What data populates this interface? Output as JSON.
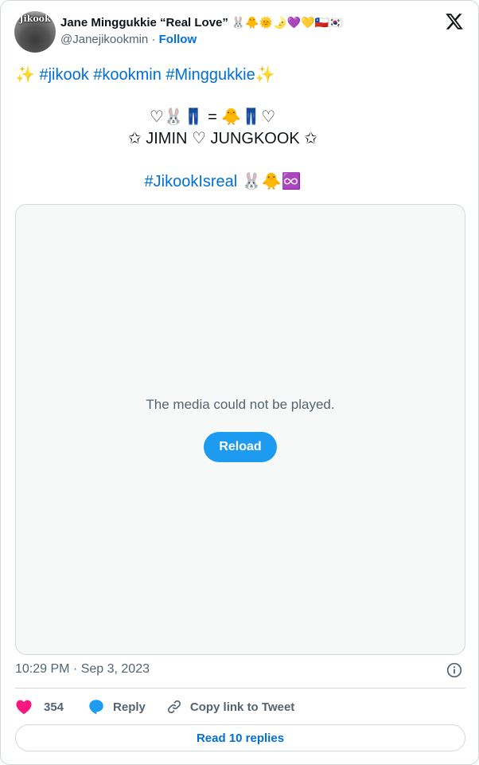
{
  "author": {
    "avatar_text": "Jikook",
    "display_name": "Jane Minggukkie “Real Love”",
    "name_emojis": "🐰🐥🌞🌛💜💛🇨🇱🇰🇷",
    "handle": "@Janejikookmin",
    "separator": "·",
    "follow_label": "Follow"
  },
  "tweet": {
    "line1_lead": "✨ ",
    "line1_tags": "#jikook #kookmin #Minggukkie",
    "line1_trail": "✨",
    "line2": "♡🐰👖 = 🐥👖♡",
    "line3": "✩  JIMIN ♡ JUNGKOOK   ✩",
    "line4_tag": "#JikookIsreal",
    "line4_emojis": " 🐰🐥♾️"
  },
  "media": {
    "message": "The media could not be played.",
    "reload_label": "Reload"
  },
  "meta": {
    "timestamp": "10:29 PM · Sep 3, 2023"
  },
  "actions": {
    "likes": "354",
    "reply_label": "Reply",
    "copy_label": "Copy link to Tweet",
    "read_replies_label": "Read 10 replies"
  },
  "colors": {
    "accent": "#1d9bf0",
    "link": "#006fd6",
    "like": "#f91880",
    "muted": "#536471",
    "border": "#cfd9de"
  },
  "icons": [
    "x-logo-icon",
    "info-icon",
    "heart-icon",
    "reply-bubble-icon",
    "link-icon"
  ]
}
